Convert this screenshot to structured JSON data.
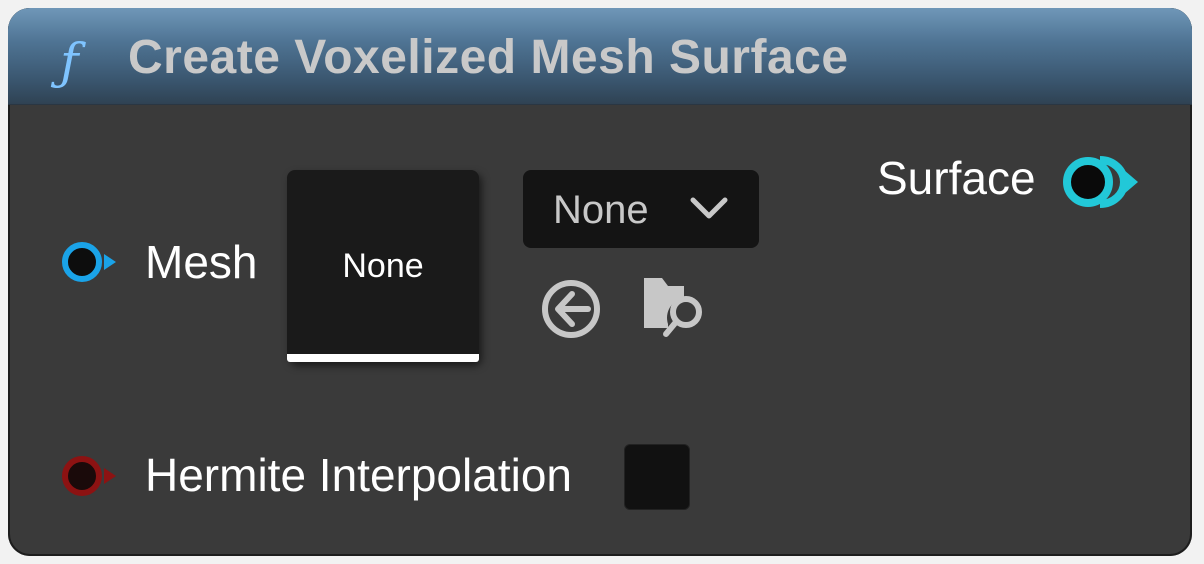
{
  "node": {
    "title": "Create Voxelized Mesh Surface",
    "title_icon": "function-icon"
  },
  "pins": {
    "mesh": {
      "label": "Mesh",
      "color": "#1aa3e8"
    },
    "hermite": {
      "label": "Hermite Interpolation",
      "color": "#8c1212"
    },
    "surface": {
      "label": "Surface",
      "color": "#22c8d8"
    }
  },
  "mesh_picker": {
    "thumbnail_text": "None",
    "dropdown_value": "None",
    "use_selected_icon": "use-selected-arrow-icon",
    "browse_icon": "browse-folder-search-icon"
  },
  "hermite_checkbox": {
    "checked": false
  },
  "colors": {
    "node_body": "#3a3a3a",
    "header_accent": "#4f7494",
    "title_text": "#c9c9c9"
  }
}
